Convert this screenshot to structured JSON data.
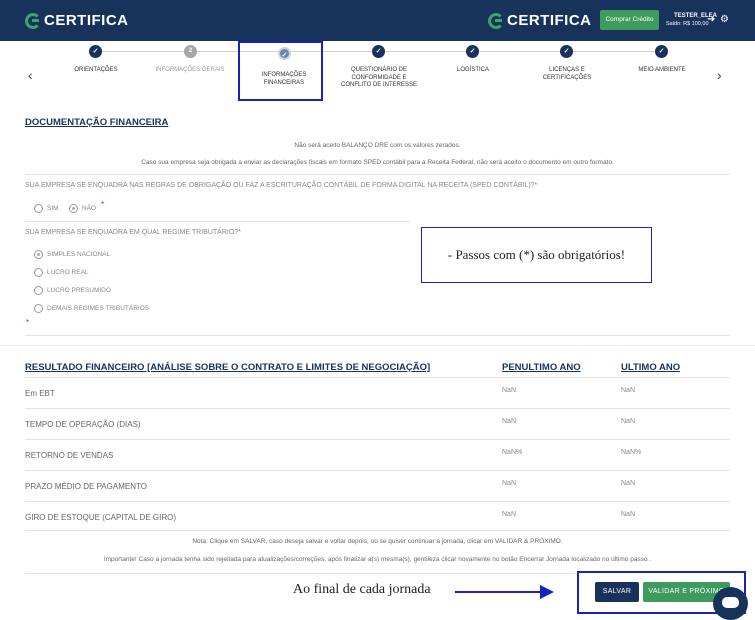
{
  "header": {
    "logo_left": "CERTIFICA",
    "logo_right": "CERTIFICA",
    "credit_button": "Comprar Crédito",
    "user_name": "TESTER_ELEA",
    "user_balance": "Saldo: R$ 100,00"
  },
  "stepper": {
    "steps": [
      {
        "label": "ORIENTAÇÕES",
        "state": "done"
      },
      {
        "label": "INFORMAÇÕES GERAIS",
        "state": "pending",
        "number": "2"
      },
      {
        "label": "INFORMAÇÕES FINANCEIRAS",
        "state": "current"
      },
      {
        "label": "QUESTIONÁRIO DE CONFORMIDADE E CONFLITO DE INTERESSE",
        "state": "done"
      },
      {
        "label": "LOGÍSTICA",
        "state": "done"
      },
      {
        "label": "LICENÇAS E CERTIFICAÇÕES",
        "state": "done"
      },
      {
        "label": "MEIO AMBIENTE",
        "state": "done"
      }
    ]
  },
  "documentation": {
    "title": "DOCUMENTAÇÃO FINANCEIRA",
    "notice_1": "Não será aceito BALANÇO DRE com os valores zerados.",
    "notice_2": "Caso sua empresa seja obrigada a enviar as declarações fiscais em formato SPED contábil para a Receita Federal, não será aceito o documento em outro formato.",
    "question_1": "SUA EMPRESA SE ENQUADRA NAS REGRAS DE OBRIGAÇÃO OU FAZ A ESCRITURAÇÃO CONTÁBIL DE FORMA DIGITAL NA RECEITA (SPED CONTÁBIL)?*",
    "q1_options": [
      "SIM",
      "NÃO"
    ],
    "q1_selected": "NÃO",
    "question_2": "SUA EMPRESA SE ENQUADRA EM QUAL REGIME TRIBUTÁRIO?*",
    "q2_options": [
      "SIMPLES NACIONAL",
      "LUCRO REAL",
      "LUCRO PRESUMIDO",
      "DEMAIS REGIMES TRIBUTÁRIOS"
    ],
    "q2_selected": "SIMPLES NACIONAL",
    "required_mark": "*"
  },
  "callout": {
    "text": "- Passos com (*) são obrigatórios!"
  },
  "results": {
    "title": "RESULTADO FINANCEIRO [ANÁLISE SOBRE O CONTRATO E LIMITES DE NEGOCIAÇÃO]",
    "col_penultimate": "PENULTIMO ANO",
    "col_last": "ULTIMO ANO",
    "rows": [
      {
        "label": "Em EBT",
        "penultimate": "NaN",
        "last": "NaN"
      },
      {
        "label": "TEMPO DE OPERAÇÃO (DIAS)",
        "penultimate": "NaN",
        "last": "NaN"
      },
      {
        "label": "RETORNO DE VENDAS",
        "penultimate": "NaN%",
        "last": "NaN%"
      },
      {
        "label": "PRAZO MÉDIO DE PAGAMENTO",
        "penultimate": "NaN",
        "last": "NaN"
      },
      {
        "label": "GIRO DE ESTOQUE (CAPITAL DE GIRO)",
        "penultimate": "NaN",
        "last": "NaN"
      }
    ]
  },
  "notes": {
    "note_1": "Nota: Clique em SALVAR, caso deseja salvar e voltar depois, ou se quiser continuar a jornada, clicar em VALIDAR & PRÓXIMO.",
    "note_2": "Importante! Caso a jornada tenha sido rejeitada para atualizações/correções, após finalizar a(s) mesma(s), gentileza clicar novamente no botão Encerrar Jornada localizado no último passo ."
  },
  "footer": {
    "caption": "Ao final de cada jornada",
    "save_button": "SALVAR",
    "next_button": "VALIDAR E PRÓXIMO"
  },
  "colors": {
    "navy": "#17335c",
    "green": "#3e9a5d",
    "annotation_blue": "#1a23b8"
  }
}
